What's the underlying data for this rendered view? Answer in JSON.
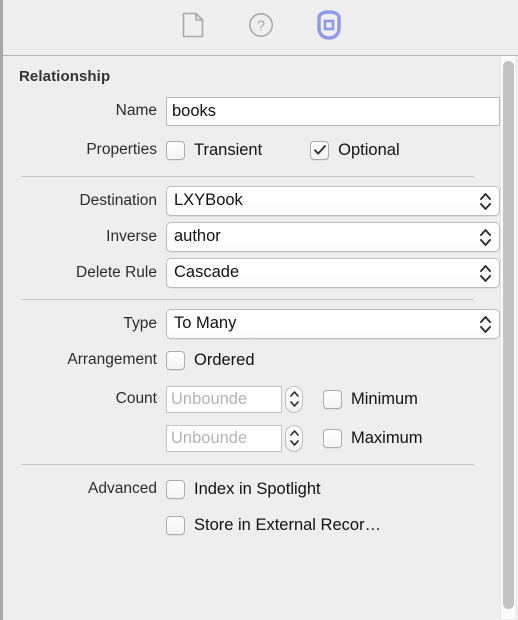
{
  "toolbar": {
    "buttons": [
      {
        "name": "file-inspector-icon",
        "label": "File inspector",
        "selected": false
      },
      {
        "name": "quick-help-icon",
        "label": "Quick Help inspector",
        "selected": false
      },
      {
        "name": "relationship-inspector-icon",
        "label": "Data model inspector",
        "selected": true
      }
    ],
    "accent_color": "#8f98ea"
  },
  "inspector": {
    "section_title": "Relationship",
    "name": {
      "label": "Name",
      "value": "books"
    },
    "properties": {
      "label": "Properties",
      "transient": {
        "label": "Transient",
        "checked": false
      },
      "optional": {
        "label": "Optional",
        "checked": true
      }
    },
    "destination": {
      "label": "Destination",
      "value": "LXYBook"
    },
    "inverse": {
      "label": "Inverse",
      "value": "author"
    },
    "delete_rule": {
      "label": "Delete Rule",
      "value": "Cascade"
    },
    "type": {
      "label": "Type",
      "value": "To Many"
    },
    "arrangement": {
      "label": "Arrangement",
      "ordered": {
        "label": "Ordered",
        "checked": false
      }
    },
    "count": {
      "label": "Count",
      "minimum": {
        "placeholder": "Unbounde",
        "value": "",
        "checkbox_label": "Minimum",
        "checked": false
      },
      "maximum": {
        "placeholder": "Unbounde",
        "value": "",
        "checkbox_label": "Maximum",
        "checked": false
      }
    },
    "advanced": {
      "label": "Advanced",
      "index_in_spotlight": {
        "label": "Index in Spotlight",
        "checked": false
      },
      "store_in_external_record": {
        "label": "Store in External Recor…",
        "checked": false
      }
    }
  }
}
